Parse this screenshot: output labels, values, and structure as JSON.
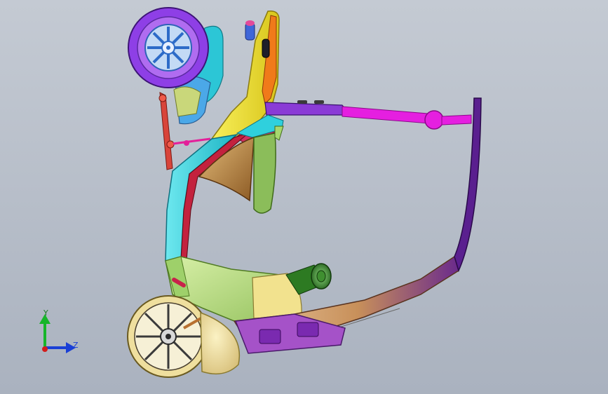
{
  "viewport": {
    "background_top": "#c4cad3",
    "background_bottom": "#aab2bf"
  },
  "triad": {
    "y_label": "Y",
    "z_label": "Z",
    "y_color": "#17b52a",
    "z_color": "#1a3fd6",
    "x_color": "#d21c1c"
  },
  "model": {
    "colors": {
      "wheel": "#7a3ddc",
      "hub": "#4b7fd1",
      "handlebar": "#e81fd8",
      "fork": "#f2e22a",
      "frame_cyan": "#2fd0dd",
      "frame_red": "#c3223e",
      "fender_gold": "#b98343",
      "seat_post": "#8bbd5a",
      "floor": "#bcdf8a",
      "tail_purple": "#5a1f8f",
      "motor_green": "#2d7a22",
      "rear_tire": "#efdf9e",
      "cover": "#f3e6a2",
      "battery_box": "#a552c8"
    }
  }
}
